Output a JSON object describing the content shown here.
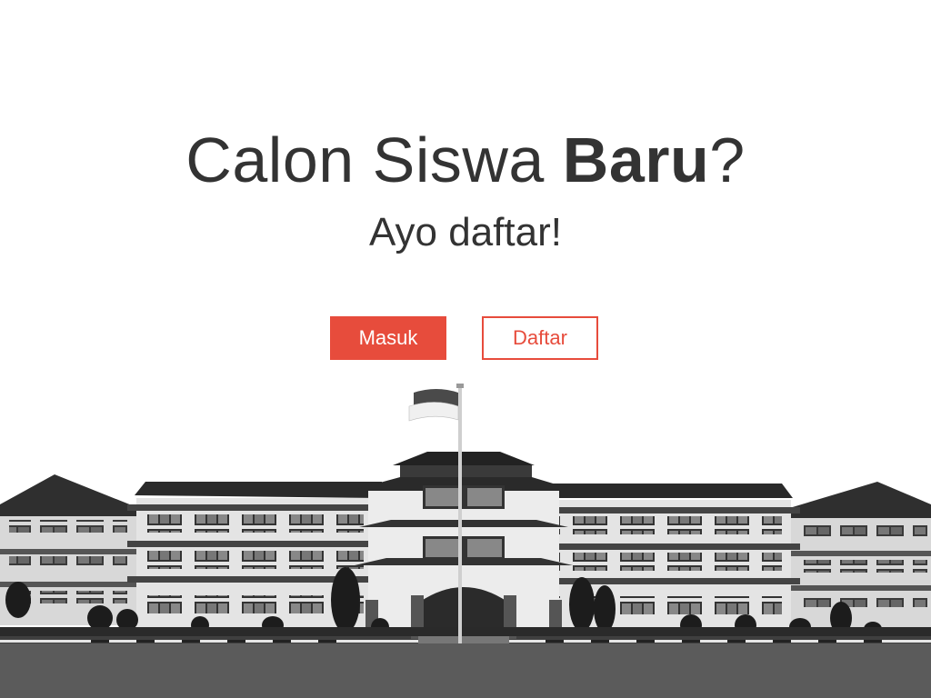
{
  "hero": {
    "title_part1": "Calon Siswa ",
    "title_bold": "Baru",
    "title_part2": "?",
    "subtitle": "Ayo daftar!"
  },
  "buttons": {
    "masuk": "Masuk",
    "daftar": "Daftar"
  },
  "colors": {
    "accent": "#e74c3c",
    "text": "#333333",
    "background": "#ffffff"
  }
}
